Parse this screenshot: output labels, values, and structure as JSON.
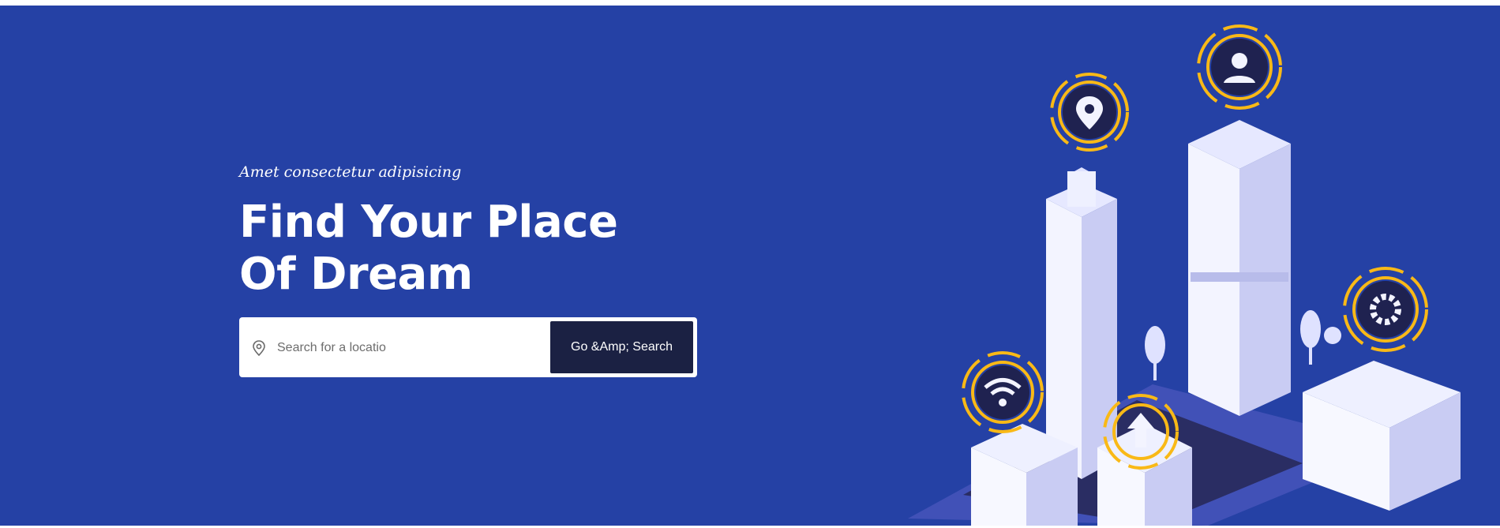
{
  "hero": {
    "eyebrow": "Amet consectetur adipisicing",
    "title_line1": "Find Your Place",
    "title_line2": "Of Dream",
    "background_color": "#2541a5"
  },
  "search": {
    "placeholder": "Search for a locatio",
    "button_label": "Go &Amp; Search",
    "button_color": "#1b2143",
    "icon": "location-pin-icon"
  },
  "illustration": {
    "subject": "isometric-city",
    "icons": [
      "location-pin-icon",
      "user-icon",
      "gear-icon",
      "wifi-icon",
      "upload-arrow-icon"
    ],
    "accent_color": "#f9b917"
  }
}
